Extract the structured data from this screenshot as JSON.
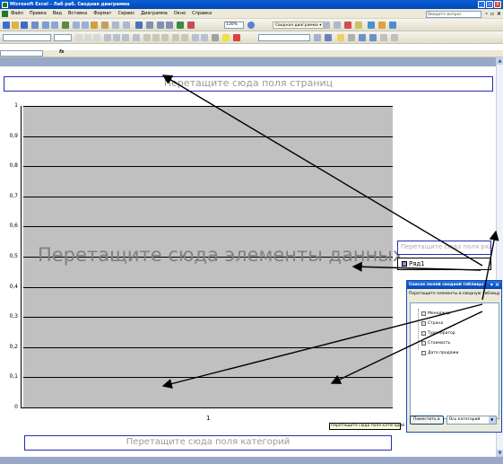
{
  "window": {
    "title": "Microsoft Excel - Лаб раб. Сводная диаграмма"
  },
  "menu": [
    "Файл",
    "Правка",
    "Вид",
    "Вставка",
    "Формат",
    "Сервис",
    "Диаграмма",
    "Окно",
    "Справка"
  ],
  "help_placeholder": "Введите вопрос",
  "toolbar": {
    "zoom": "130%",
    "pivot_chart_button": "Сводная диаграмма ▾"
  },
  "chart": {
    "page_drop": "Перетащите сюда поля страниц",
    "data_drop": "Перетащите сюда элементы данных",
    "category_drop": "Перетащите сюда поля категорий",
    "series_drop": "Перетащите сюда поля рядов",
    "category_tooltip": "Перетащите сюда поля категорий",
    "legend_item": "Ряд1",
    "x_tick": "1"
  },
  "chart_data": {
    "type": "bar",
    "categories": [
      "1"
    ],
    "series": [
      {
        "name": "Ряд1",
        "values": []
      }
    ],
    "yticks": [
      "0",
      "0,1",
      "0,2",
      "0,3",
      "0,4",
      "0,5",
      "0,6",
      "0,7",
      "0,8",
      "0,9",
      "1"
    ],
    "ylim": [
      0,
      1
    ]
  },
  "field_list": {
    "title": "Список полей сводной таблицы",
    "description": "Перетащите элементы в сводную таблицу",
    "fields": [
      "Менеджер",
      "Страна",
      "Туроператор",
      "Стоимость",
      "Дата продажи"
    ],
    "add_button": "Поместить в",
    "area_select": "Ось категорий"
  },
  "colors": {
    "plot_bg": "#c0c0c0",
    "drop_border": "#262bb8",
    "title_bar": "#0a5fd8"
  }
}
